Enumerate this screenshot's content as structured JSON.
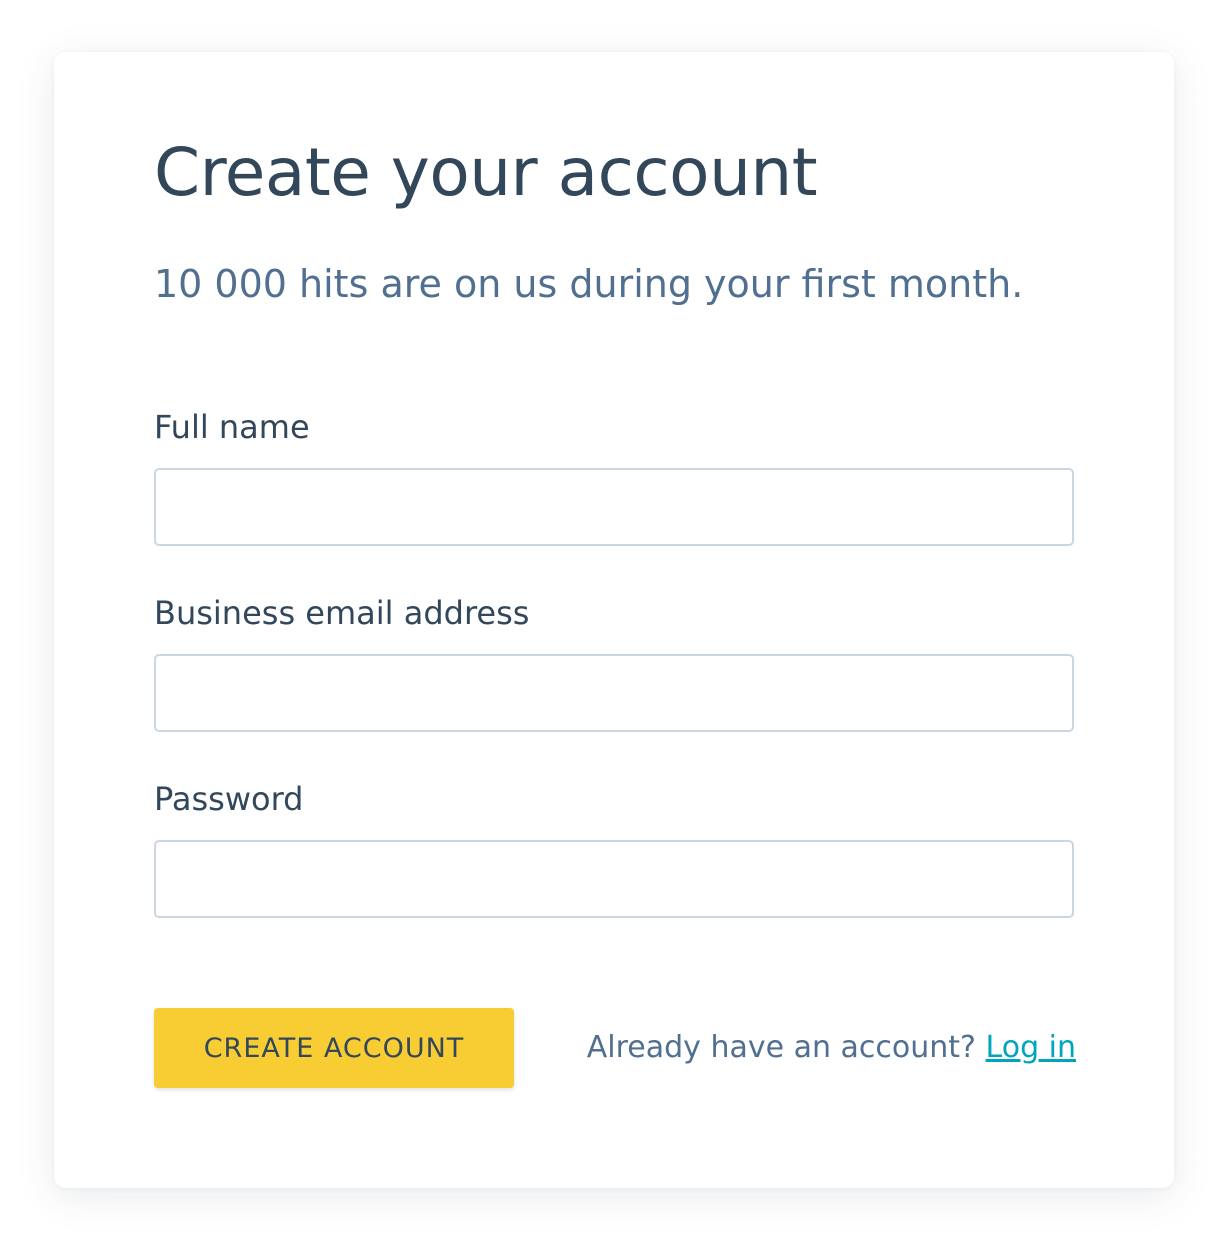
{
  "signup": {
    "title": "Create your account",
    "subtitle": "10 000 hits are on us during your first month.",
    "fields": [
      {
        "label": "Full name",
        "value": "",
        "placeholder": ""
      },
      {
        "label": "Business email address",
        "value": "",
        "placeholder": ""
      },
      {
        "label": "Password",
        "value": "",
        "placeholder": ""
      }
    ],
    "submit_label": "CREATE ACCOUNT",
    "login_prompt": "Already have an account?",
    "login_link": "Log in"
  },
  "colors": {
    "heading": "#33475b",
    "subtitle": "#516f90",
    "button": "#f8cc33",
    "link": "#00a4bd",
    "input_border": "#cbd6e2"
  }
}
